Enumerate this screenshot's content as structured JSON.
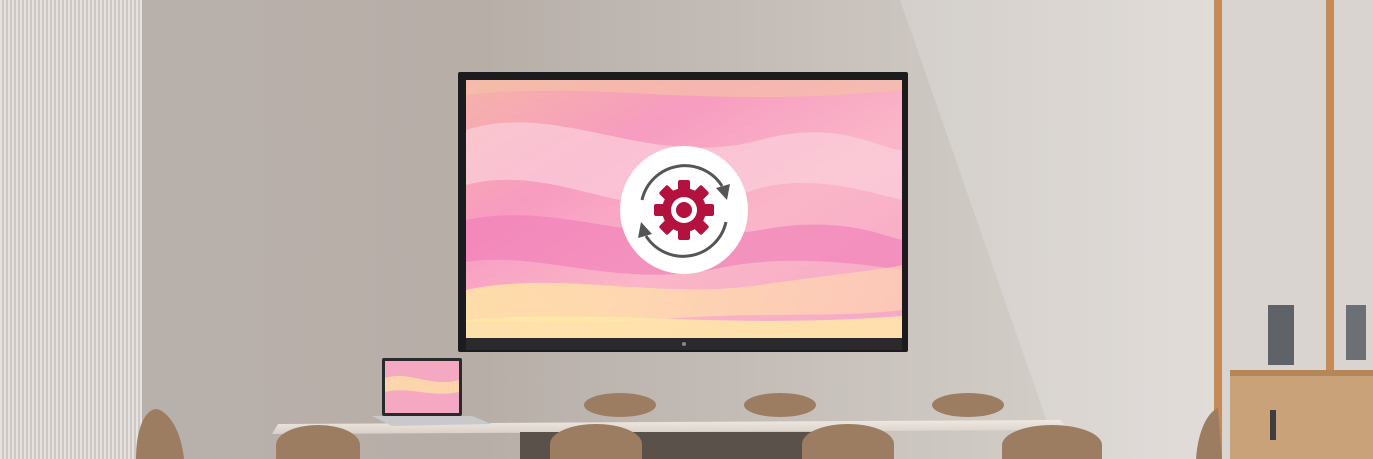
{
  "scene": {
    "description_icon": "gear-with-refresh-arrows-icon",
    "colors": {
      "wall": "#c9c2bd",
      "screen_pink": "#f7a4c0",
      "gear": "#b3123e",
      "arrows": "#555555",
      "badge": "#ffffff",
      "wood": "#b88a5a",
      "chair": "#9a7a60"
    }
  }
}
